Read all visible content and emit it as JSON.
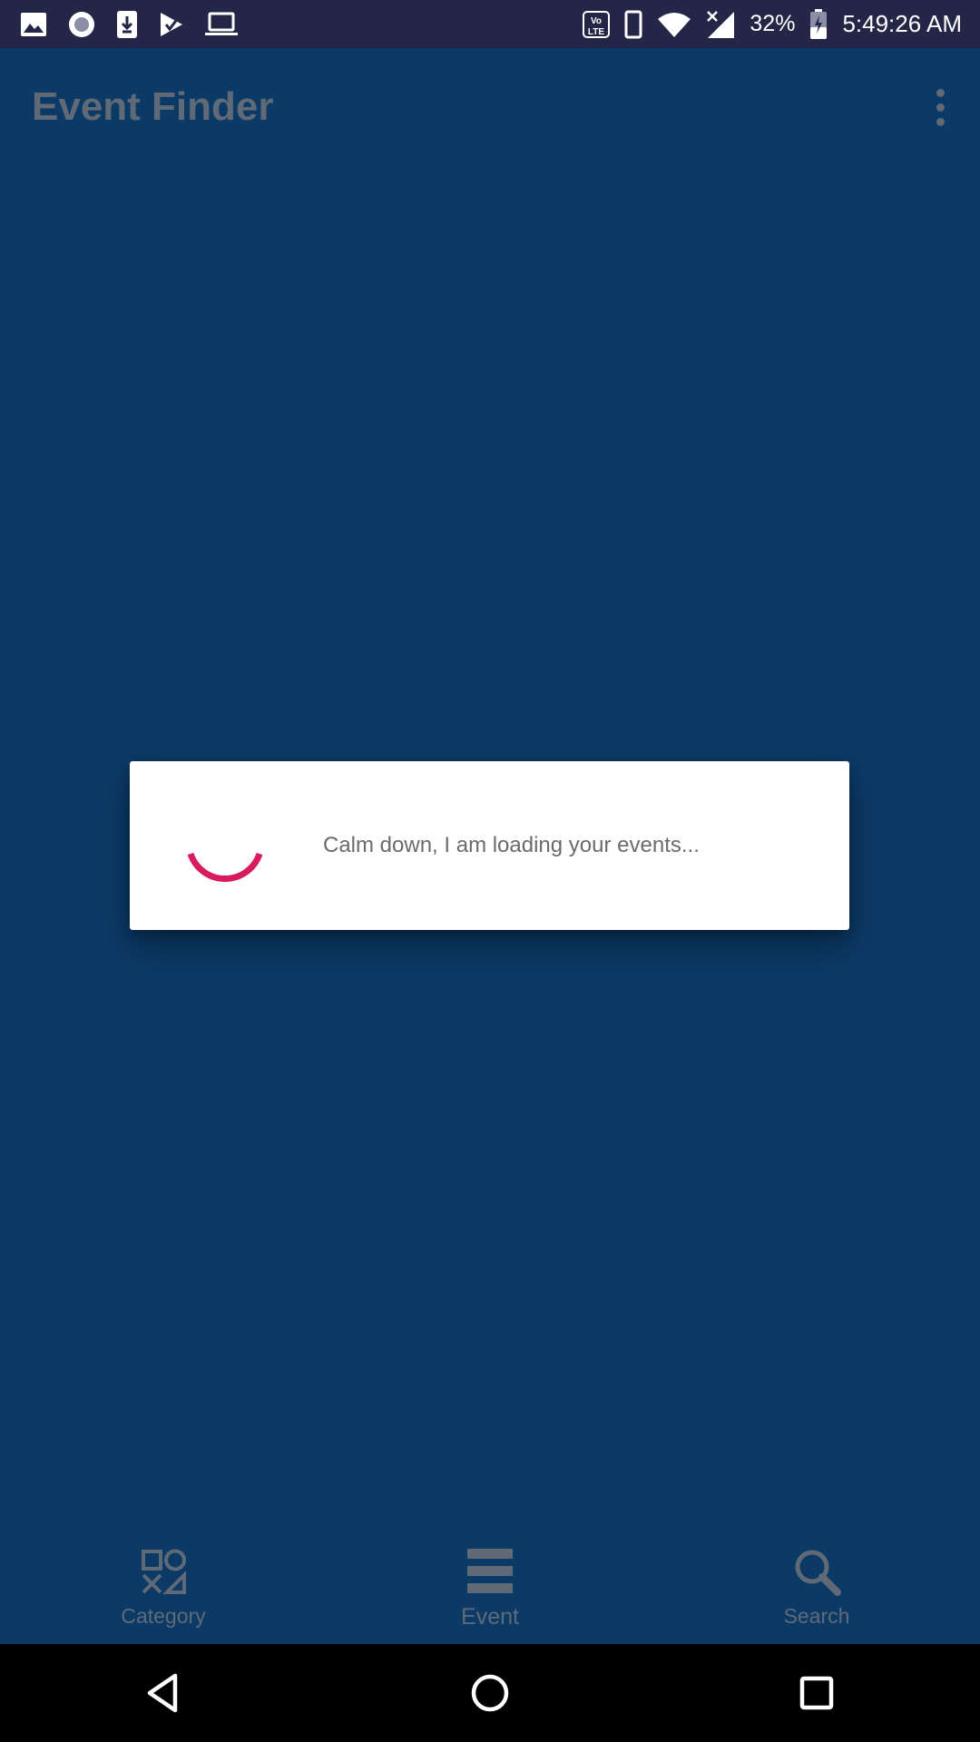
{
  "status_bar": {
    "left_icons": [
      "gallery-icon",
      "record-icon",
      "download-icon",
      "play-store-icon",
      "laptop-icon"
    ],
    "right_icons": [
      "volte-icon",
      "phone-icon",
      "wifi-icon",
      "signal-icon",
      "battery-icon"
    ],
    "battery": "32%",
    "time": "5:49:26 AM"
  },
  "app_bar": {
    "title": "Event Finder",
    "menu_icon": "more-vert-icon"
  },
  "dialog": {
    "message": "Calm down, I am loading your events...",
    "spinner_color": "#d81b60"
  },
  "bottom_nav": {
    "items": [
      {
        "label": "Category",
        "icon": "category-icon"
      },
      {
        "label": "Event",
        "icon": "list-icon"
      },
      {
        "label": "Search",
        "icon": "search-icon"
      }
    ]
  },
  "system_nav": {
    "buttons": [
      "back-icon",
      "home-icon",
      "recents-icon"
    ]
  },
  "colors": {
    "background": "#0c3a67",
    "status_bar": "#232646",
    "muted": "#5f6a76",
    "accent": "#d81b60"
  }
}
